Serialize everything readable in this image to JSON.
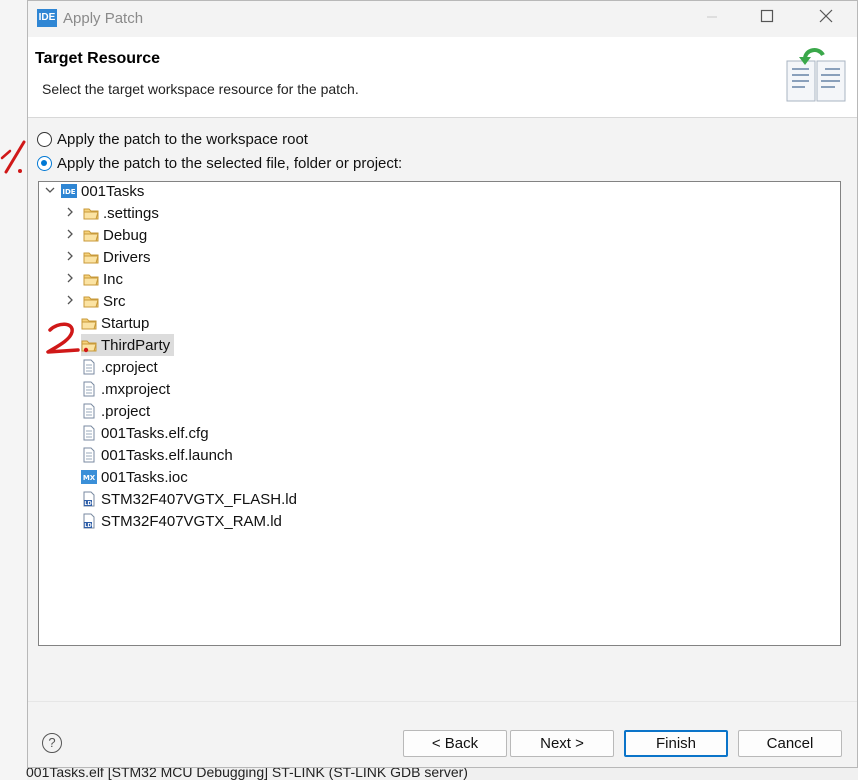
{
  "background": {
    "status_text": "001Tasks.elf [STM32 MCU Debugging] ST-LINK (ST-LINK GDB server)"
  },
  "window": {
    "title": "Apply Patch",
    "app_icon_text": "IDE"
  },
  "header": {
    "title": "Target Resource",
    "description": "Select the target workspace resource for the patch."
  },
  "options": [
    {
      "label": "Apply the patch to the workspace root",
      "checked": false
    },
    {
      "label": "Apply the patch to the selected file, folder or project:",
      "checked": true
    }
  ],
  "tree": {
    "root": {
      "label": "001Tasks",
      "icon": "project-icon",
      "icon_text": "IDE",
      "expanded": true
    },
    "items": [
      {
        "label": ".settings",
        "icon": "folder-icon",
        "expandable": true
      },
      {
        "label": "Debug",
        "icon": "folder-icon",
        "expandable": true
      },
      {
        "label": "Drivers",
        "icon": "folder-icon",
        "expandable": true
      },
      {
        "label": "Inc",
        "icon": "folder-icon",
        "expandable": true
      },
      {
        "label": "Src",
        "icon": "folder-icon",
        "expandable": true
      },
      {
        "label": "Startup",
        "icon": "folder-icon",
        "expandable": false
      },
      {
        "label": "ThirdParty",
        "icon": "folder-icon",
        "expandable": false,
        "selected": true
      },
      {
        "label": ".cproject",
        "icon": "file-icon"
      },
      {
        "label": ".mxproject",
        "icon": "file-icon"
      },
      {
        "label": ".project",
        "icon": "file-icon"
      },
      {
        "label": "001Tasks.elf.cfg",
        "icon": "file-icon"
      },
      {
        "label": "001Tasks.elf.launch",
        "icon": "file-icon"
      },
      {
        "label": "001Tasks.ioc",
        "icon": "mx-icon",
        "icon_text": "MX"
      },
      {
        "label": "STM32F407VGTX_FLASH.ld",
        "icon": "ld-file-icon",
        "icon_text": "LD"
      },
      {
        "label": "STM32F407VGTX_RAM.ld",
        "icon": "ld-file-icon",
        "icon_text": "LD"
      }
    ]
  },
  "buttons": {
    "help": "?",
    "back": "< Back",
    "next": "Next >",
    "finish": "Finish",
    "cancel": "Cancel"
  },
  "colors": {
    "accent": "#0078d4",
    "annotation": "#d01818",
    "selection": "#dcdcdc"
  }
}
